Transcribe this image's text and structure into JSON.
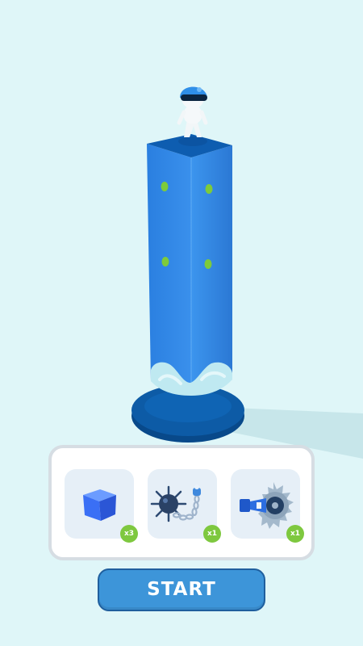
{
  "scene": {
    "background": "#dff6f8",
    "pillar_color": "#2f86e6",
    "base_color": "#0d5ba6",
    "dot_color": "#7ecb3a"
  },
  "inventory": {
    "items": [
      {
        "name": "cube",
        "icon": "blue-cube-icon",
        "count": "x3"
      },
      {
        "name": "spiked-flail",
        "icon": "spiked-ball-chain-icon",
        "count": "x1"
      },
      {
        "name": "saw-blade",
        "icon": "circular-saw-icon",
        "count": "x1"
      }
    ]
  },
  "start_button": {
    "label": "START"
  }
}
